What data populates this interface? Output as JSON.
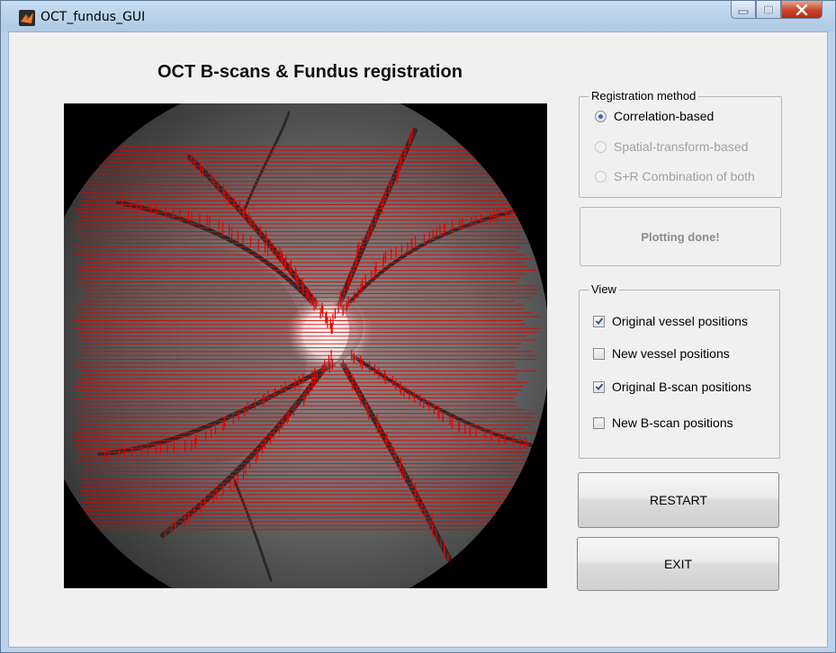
{
  "window": {
    "title": "OCT_fundus_GUI",
    "controls": {
      "minimize_icon": "minimize-icon",
      "maximize_icon": "maximize-icon",
      "close_icon": "close-icon"
    }
  },
  "heading": "OCT B-scans & Fundus registration",
  "plot": {
    "image": "fundus-image-with-bscan-lines",
    "overlay_color": "#e60000"
  },
  "registration": {
    "title": "Registration method",
    "options": [
      {
        "label": "Correlation-based",
        "selected": true,
        "enabled": true
      },
      {
        "label": "Spatial-transform-based",
        "selected": false,
        "enabled": false
      },
      {
        "label": "S+R Combination of both",
        "selected": false,
        "enabled": false
      }
    ]
  },
  "status": "Plotting done!",
  "view": {
    "title": "View",
    "options": [
      {
        "label": "Original vessel positions",
        "checked": true
      },
      {
        "label": "New vessel positions",
        "checked": false
      },
      {
        "label": "Original B-scan positions",
        "checked": true
      },
      {
        "label": "New B-scan positions",
        "checked": false
      }
    ]
  },
  "buttons": {
    "restart": "RESTART",
    "exit": "EXIT"
  },
  "colors": {
    "client_bg": "#f0f0f0",
    "overlay": "#e60000",
    "accent": "#2d6bb0"
  }
}
